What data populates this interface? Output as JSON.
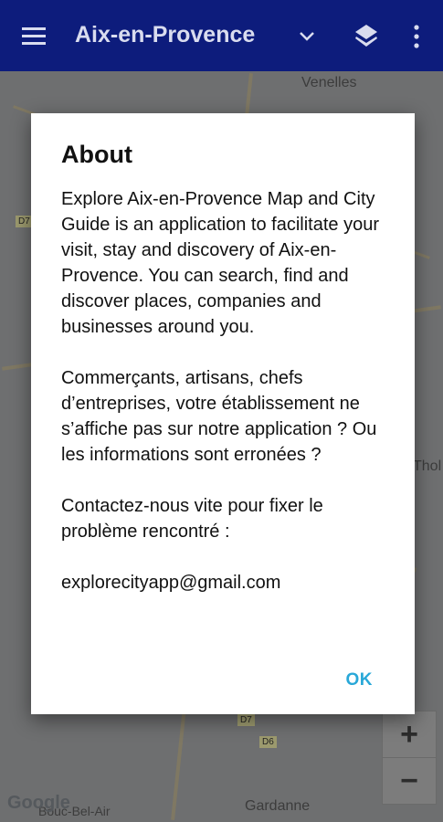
{
  "appbar": {
    "title": "Aix-en-Provence",
    "menu_icon": "hamburger-menu-icon",
    "dropdown_icon": "chevron-down-icon",
    "layers_icon": "layers-icon",
    "more_icon": "more-vert-icon",
    "color": "#0d1c7c"
  },
  "map": {
    "labels": {
      "venelles": "Venelles",
      "gardanne": "Gardanne",
      "bouc": "Bouc-Bel-Air",
      "thol": "Thol"
    },
    "badges": {
      "d7_top": "D7",
      "d7_bottom": "D7",
      "d6": "D6"
    },
    "zoom_in": "+",
    "zoom_out": "−",
    "attribution": "Google"
  },
  "dialog": {
    "title": "About",
    "body": "Explore Aix-en-Provence Map and City Guide is an application to facilitate your visit, stay and discovery of Aix-en-Provence. You can search, find and discover places, companies and businesses around you.\n\n Commerçants, artisans, chefs d’entreprises, votre établissement ne s’affiche pas sur notre application ? Ou les informations sont erronées ?\n\n Contactez-nous vite pour fixer le problème rencontré :\n\n explorecityapp@gmail.com",
    "ok_label": "OK",
    "accent": "#29a8d8"
  }
}
